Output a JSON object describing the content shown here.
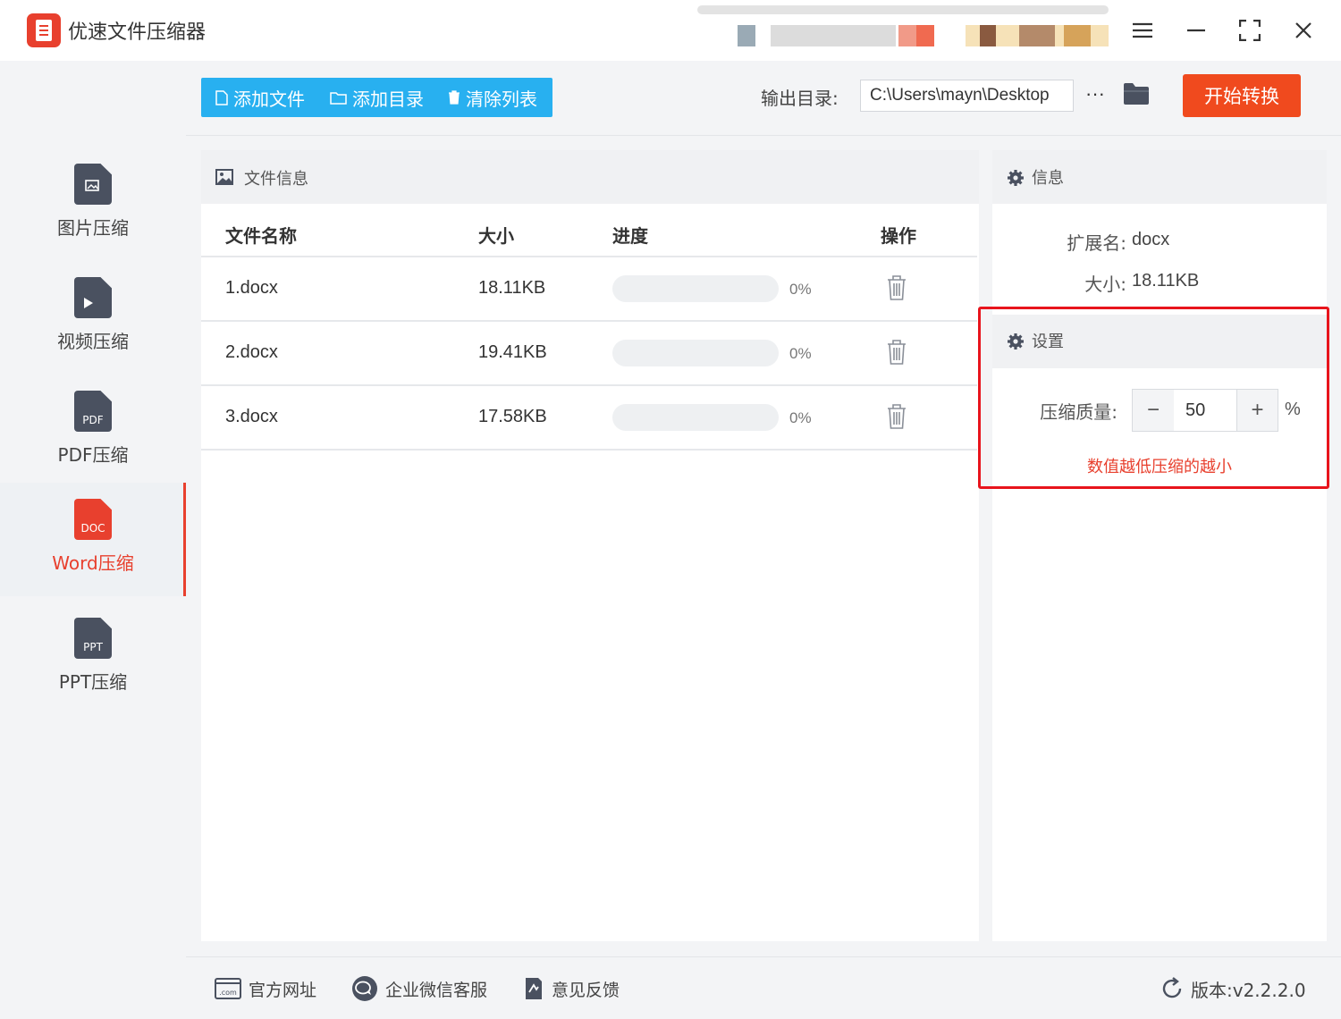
{
  "app": {
    "title": "优速文件压缩器"
  },
  "colors": {
    "accent": "#e8402e",
    "toolbar_blue": "#28b0f0",
    "start_button": "#f04a1e",
    "highlight_box": "#e8141c"
  },
  "sidebar": {
    "items": [
      {
        "label": "图片压缩",
        "icon": "image-file-icon",
        "tag": "",
        "active": false
      },
      {
        "label": "视频压缩",
        "icon": "video-file-icon",
        "tag": "",
        "active": false
      },
      {
        "label": "PDF压缩",
        "icon": "pdf-file-icon",
        "tag": "PDF",
        "active": false
      },
      {
        "label": "Word压缩",
        "icon": "doc-file-icon",
        "tag": "DOC",
        "active": true
      },
      {
        "label": "PPT压缩",
        "icon": "ppt-file-icon",
        "tag": "PPT",
        "active": false
      }
    ]
  },
  "toolbar": {
    "add_file": "添加文件",
    "add_folder": "添加目录",
    "clear_list": "清除列表",
    "output_label": "输出目录:",
    "output_path": "C:\\Users\\mayn\\Desktop",
    "more": "···",
    "start": "开始转换"
  },
  "file_panel": {
    "title": "文件信息",
    "columns": {
      "name": "文件名称",
      "size": "大小",
      "progress": "进度",
      "action": "操作"
    },
    "rows": [
      {
        "name": "1.docx",
        "size": "18.11KB",
        "progress": 0,
        "progress_text": "0%"
      },
      {
        "name": "2.docx",
        "size": "19.41KB",
        "progress": 0,
        "progress_text": "0%"
      },
      {
        "name": "3.docx",
        "size": "17.58KB",
        "progress": 0,
        "progress_text": "0%"
      }
    ]
  },
  "info_panel": {
    "title": "信息",
    "ext_label": "扩展名:",
    "ext_value": "docx",
    "size_label": "大小:",
    "size_value": "18.11KB"
  },
  "settings": {
    "title": "设置",
    "quality_label": "压缩质量:",
    "minus": "−",
    "plus": "+",
    "quality_value": "50",
    "unit": "%",
    "hint": "数值越低压缩的越小"
  },
  "footer": {
    "website": "官方网址",
    "wechat": "企业微信客服",
    "feedback": "意见反馈",
    "version": "版本:v2.2.2.0"
  }
}
